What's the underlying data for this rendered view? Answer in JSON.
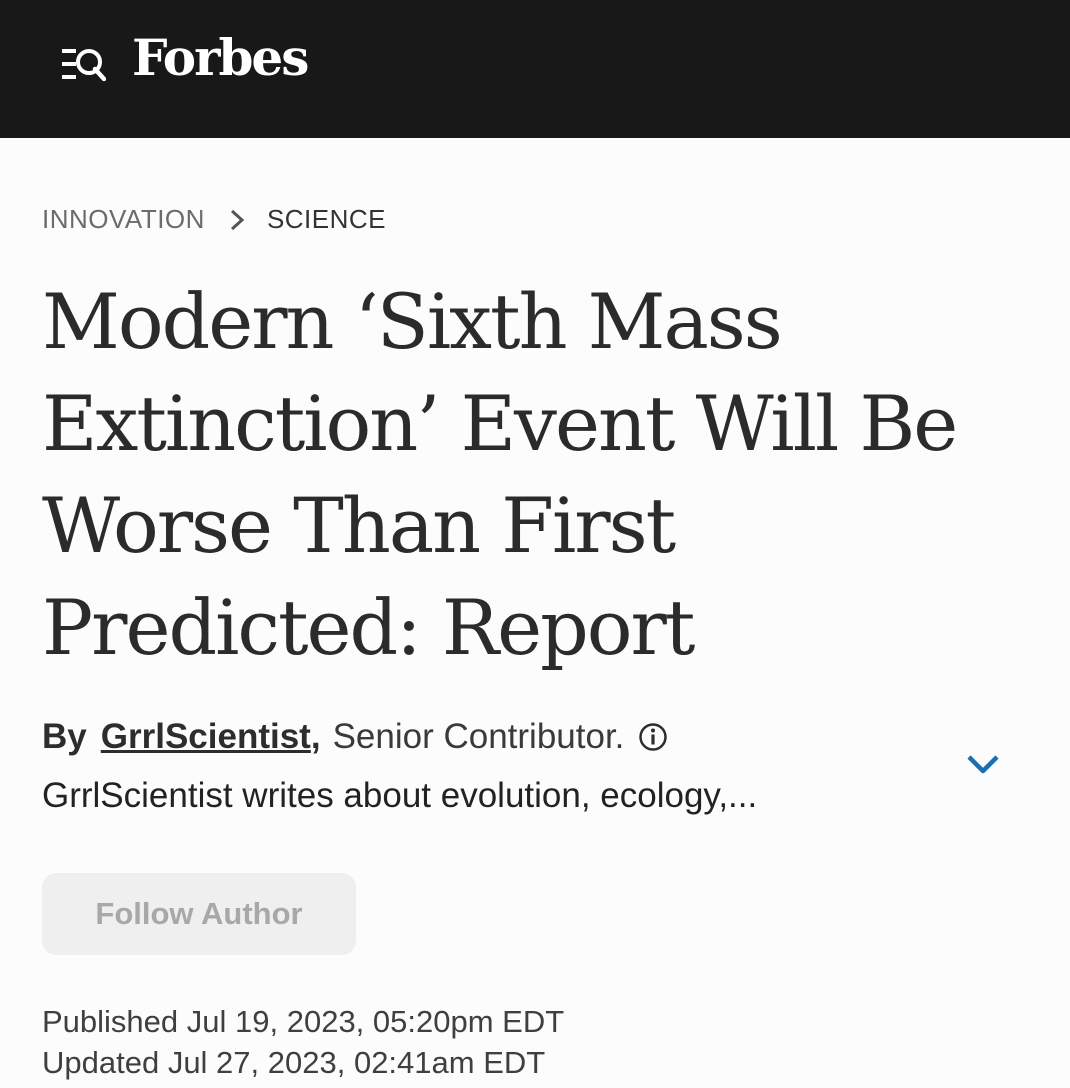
{
  "header": {
    "logo": "Forbes",
    "menu_icon": "menu-search-icon"
  },
  "breadcrumb": {
    "section": "INNOVATION",
    "subsection": "SCIENCE",
    "separator_icon": "chevron-right-icon"
  },
  "article": {
    "title": "Modern ‘Sixth Mass Extinction’ Event Will Be Worse Than First Predicted: Report",
    "by_label": "By",
    "author": "GrrlScientist",
    "comma": ",",
    "role": "Senior Contributor.",
    "author_bio": "GrrlScientist writes about evolution, ecology,...",
    "follow_label": "Follow Author",
    "published": "Published Jul 19, 2023, 05:20pm EDT",
    "updated": "Updated Jul 27, 2023, 02:41am EDT"
  },
  "colors": {
    "topbar": "#181818",
    "accent_chevron": "#1a6fb3"
  }
}
